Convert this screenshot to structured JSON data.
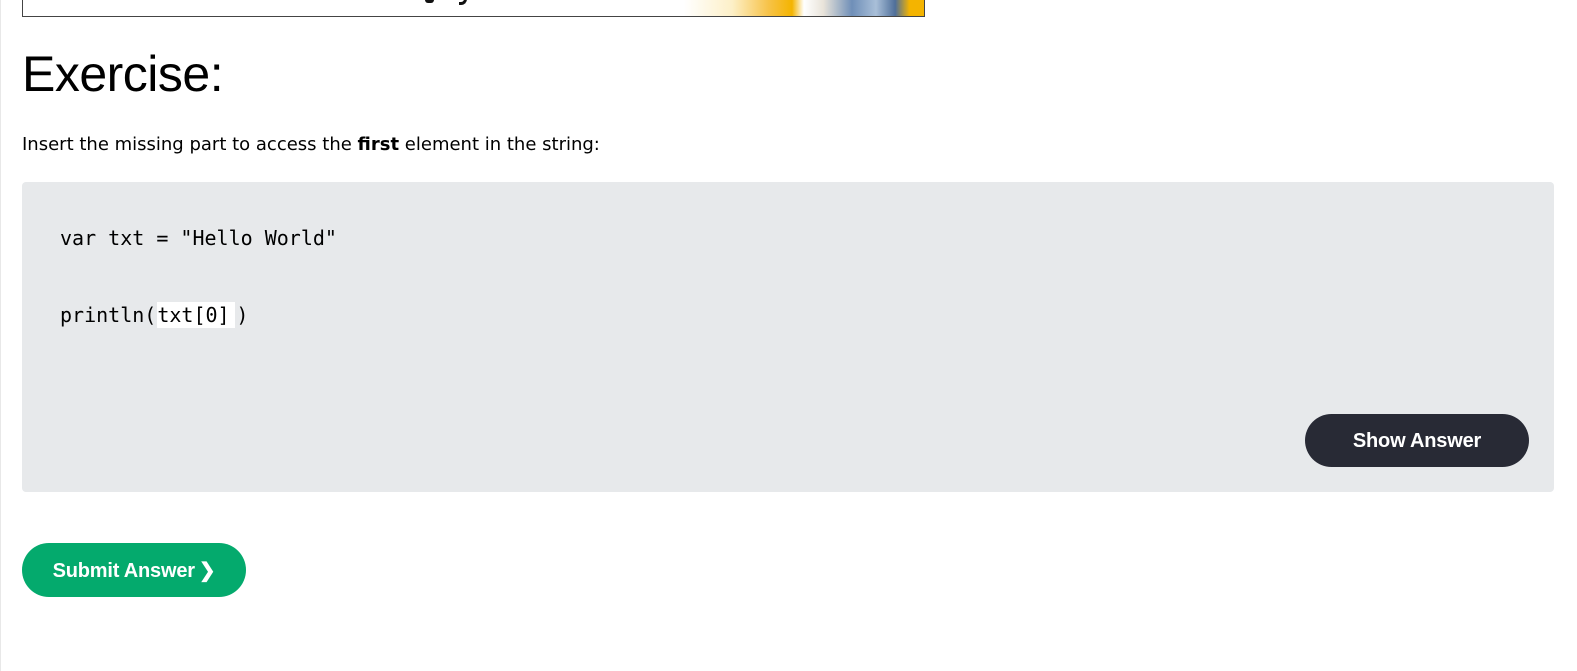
{
  "exercise": {
    "title": "Exercise:",
    "instruction_before": "Insert the missing part to access the ",
    "instruction_bold": "first",
    "instruction_after": " element in the string:"
  },
  "code": {
    "line1": "var txt = \"Hello World\"",
    "line2_prefix": "println(",
    "line2_input_value": "txt[0]",
    "line2_suffix": ")"
  },
  "buttons": {
    "show_answer": "Show Answer",
    "submit_answer": "Submit Answer",
    "submit_icon": "chevron-right-icon",
    "submit_chevron": "❯"
  },
  "colors": {
    "code_background": "#e7e9eb",
    "show_answer_background": "#282a35",
    "submit_background": "#04aa6d"
  }
}
